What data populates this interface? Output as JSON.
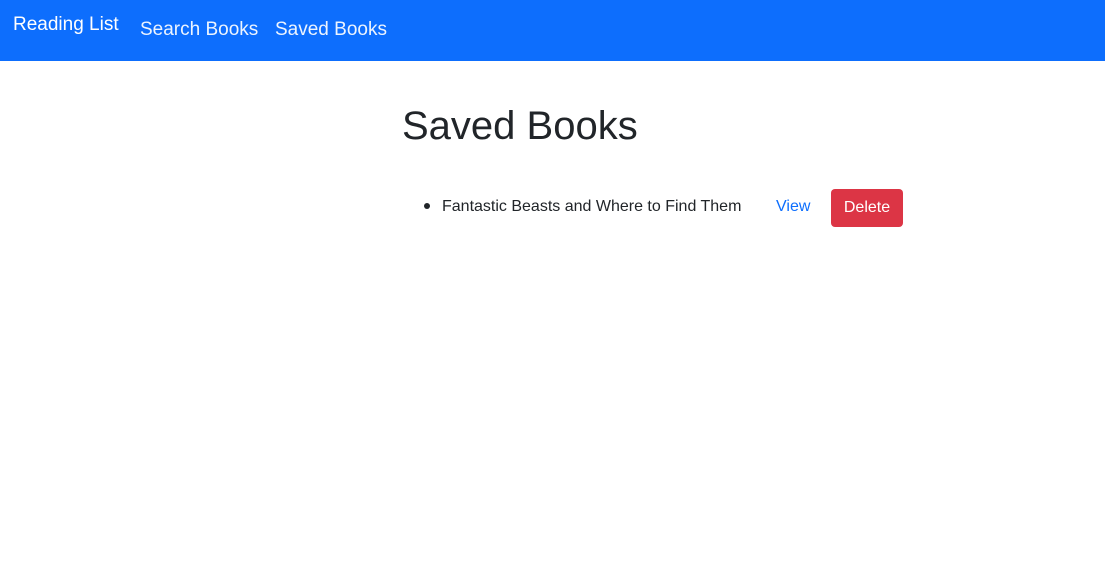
{
  "navbar": {
    "brand": "Reading List",
    "links": [
      {
        "label": "Search Books"
      },
      {
        "label": "Saved Books"
      }
    ],
    "background_color": "#0d6efd"
  },
  "main": {
    "title": "Saved Books",
    "books": [
      {
        "title": "Fantastic Beasts and Where to Find Them",
        "view_label": "View",
        "delete_label": "Delete"
      }
    ]
  },
  "colors": {
    "link": "#0d6efd",
    "danger": "#dc3545",
    "text": "#212529"
  }
}
